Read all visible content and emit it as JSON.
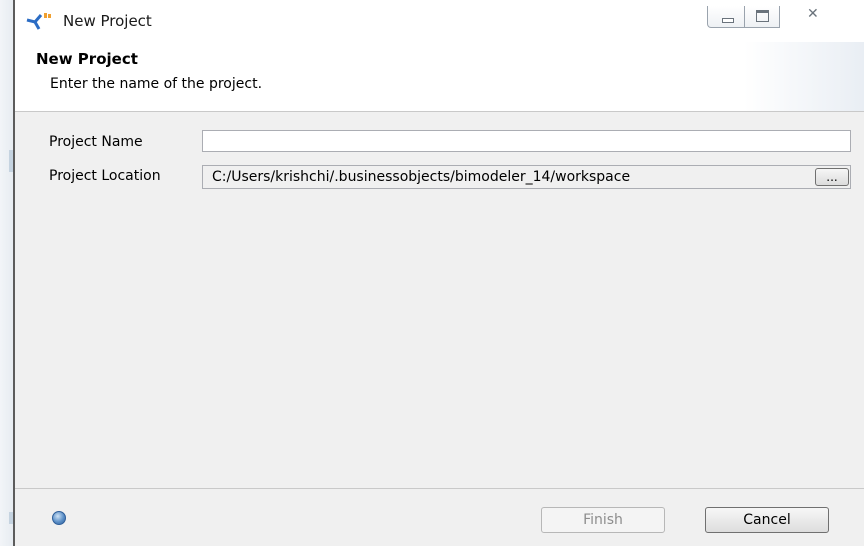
{
  "window": {
    "title": "New Project",
    "controls": {
      "close_glyph": "✕"
    }
  },
  "banner": {
    "title": "New Project",
    "subtitle": "Enter the name of the project."
  },
  "form": {
    "project_name_label": "Project Name",
    "project_name_value": "",
    "project_location_label": "Project Location",
    "project_location_value": "C:/Users/krishchi/.businessobjects/bimodeler_14/workspace",
    "browse_label": "..."
  },
  "footer": {
    "help_icon": "help-icon",
    "finish_label": "Finish",
    "cancel_label": "Cancel"
  },
  "colors": {
    "form_background": "#f0f0f0",
    "disabled_text": "#8d8d8d",
    "help_blue": "#5b8fc7"
  }
}
